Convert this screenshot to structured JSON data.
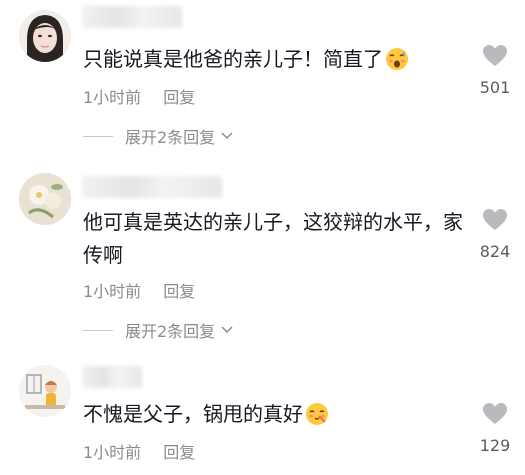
{
  "comments": [
    {
      "text": "只能说真是他爸的亲儿子！简直了",
      "emoji": "emoji-icon",
      "time": "1小时前",
      "reply": "回复",
      "expand": "展开2条回复",
      "likes": "501"
    },
    {
      "text": "他可真是英达的亲儿子，这狡辩的水平，家传啊",
      "time": "1小时前",
      "reply": "回复",
      "expand": "展开2条回复",
      "likes": "824"
    },
    {
      "text": "不愧是父子，锅甩的真好",
      "emoji": "emoji-icon",
      "time": "1小时前",
      "reply": "回复",
      "likes": "129"
    }
  ],
  "colors": {
    "text": "#161823",
    "meta": "#8a8b91",
    "heart": "#b9b9be"
  }
}
